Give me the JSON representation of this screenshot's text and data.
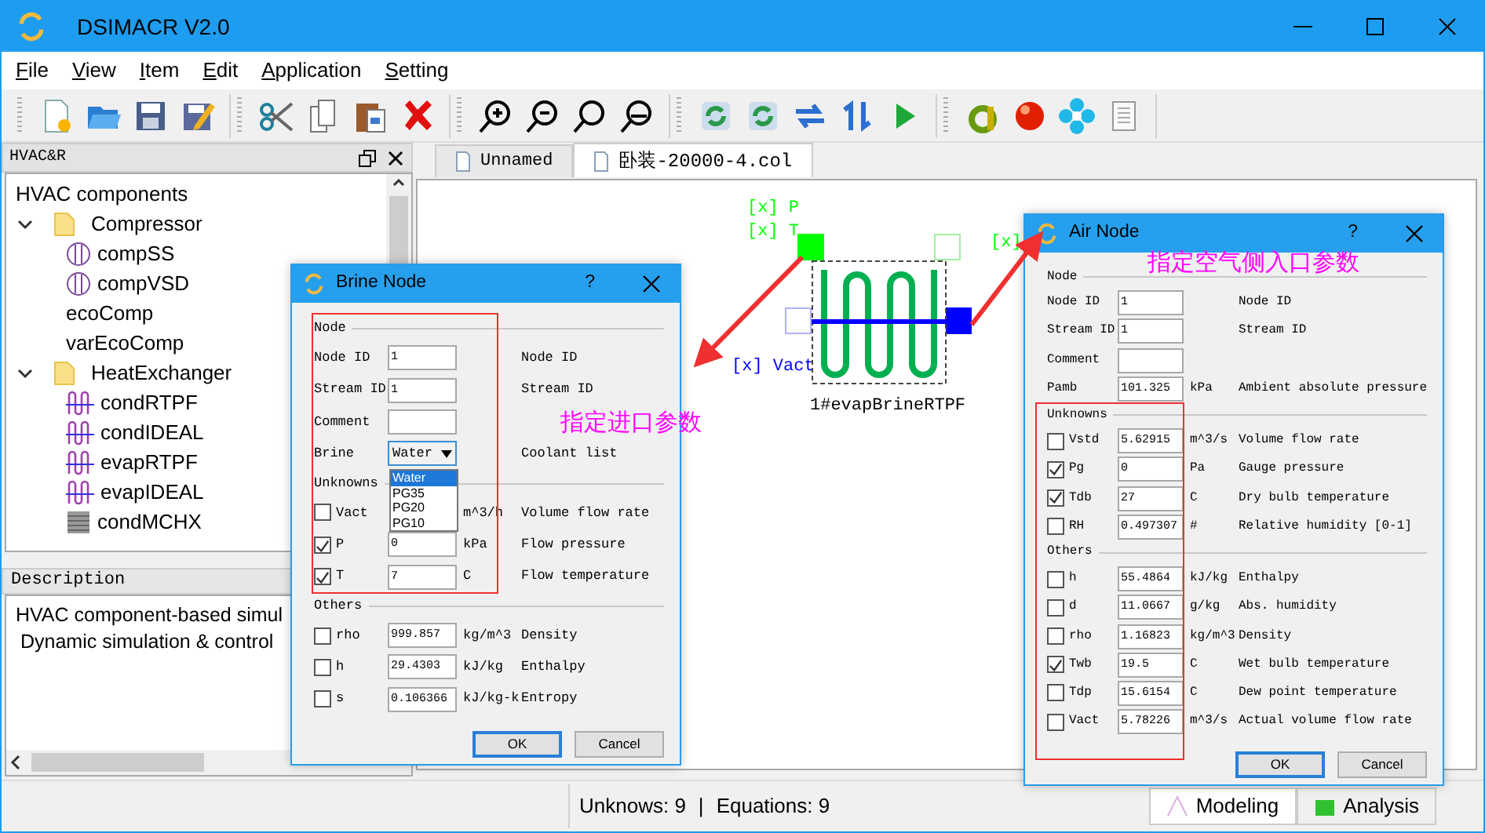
{
  "window": {
    "title": "DSIMACR V2.0"
  },
  "menu": [
    {
      "label": "File"
    },
    {
      "label": "View"
    },
    {
      "label": "Item"
    },
    {
      "label": "Edit"
    },
    {
      "label": "Application"
    },
    {
      "label": "Setting"
    }
  ],
  "dock": {
    "title": "HVAC&R"
  },
  "tree": {
    "root": "HVAC components",
    "items": [
      {
        "label": "Compressor",
        "kind": "folder",
        "expanded": true,
        "children": [
          {
            "label": "compSS",
            "kind": "compressor"
          },
          {
            "label": "compVSD",
            "kind": "compressor"
          },
          {
            "label": "ecoComp",
            "kind": "plain"
          },
          {
            "label": "varEcoComp",
            "kind": "plain"
          }
        ]
      },
      {
        "label": "HeatExchanger",
        "kind": "folder",
        "expanded": true,
        "children": [
          {
            "label": "condRTPF",
            "kind": "coil"
          },
          {
            "label": "condIDEAL",
            "kind": "coil"
          },
          {
            "label": "evapRTPF",
            "kind": "coil"
          },
          {
            "label": "evapIDEAL",
            "kind": "coil"
          },
          {
            "label": "condMCHX",
            "kind": "grid"
          }
        ]
      }
    ]
  },
  "description": {
    "title": "Description",
    "lines": [
      "HVAC component-based simul",
      "Dynamic simulation & control"
    ]
  },
  "tabs": [
    {
      "label": "Unnamed",
      "selected": false
    },
    {
      "label": "卧装-20000-4.col",
      "selected": true
    }
  ],
  "canvas": {
    "labels": [
      {
        "text": "[x] P",
        "color": "#00ff00"
      },
      {
        "text": "[x] T",
        "color": "#00ff00"
      },
      {
        "text": "[x] Vact",
        "color": "#0000ff"
      },
      {
        "text": "[x]",
        "color": "#00ff00"
      }
    ],
    "component": "1#evapBrineRTPF"
  },
  "annotations": [
    "指定进口参数",
    "指定空气侧入口参数"
  ],
  "brine_dialog": {
    "title": "Brine Node",
    "help": "?",
    "sections": [
      {
        "title": "Node",
        "rows": [
          {
            "kind": "field",
            "label": "Node ID",
            "value": "1",
            "description": "Node ID"
          },
          {
            "kind": "field",
            "label": "Stream ID",
            "value": "1",
            "description": "Stream ID"
          },
          {
            "kind": "field",
            "label": "Comment"
          },
          {
            "kind": "combo",
            "label": "Brine",
            "value": "Water",
            "description": "Coolant list",
            "options": [
              {
                "label": "Water",
                "selected": true
              },
              {
                "label": "PG35",
                "selected": false
              },
              {
                "label": "PG20",
                "selected": false
              },
              {
                "label": "PG10",
                "selected": false
              }
            ]
          }
        ]
      },
      {
        "title": "Unknowns",
        "rows": [
          {
            "kind": "check",
            "label": "Vact",
            "checked": false,
            "unit": "m^3/h",
            "description": "Volume flow rate"
          },
          {
            "kind": "check",
            "label": "P",
            "checked": true,
            "value": "0",
            "unit": "kPa",
            "description": "Flow pressure"
          },
          {
            "kind": "check",
            "label": "T",
            "checked": true,
            "value": "7",
            "unit": "C",
            "description": "Flow temperature"
          }
        ]
      },
      {
        "title": "Others",
        "rows": [
          {
            "kind": "check",
            "label": "rho",
            "checked": false,
            "value": "999.857",
            "unit": "kg/m^3",
            "description": "Density"
          },
          {
            "kind": "check",
            "label": "h",
            "checked": false,
            "value": "29.4303",
            "unit": "kJ/kg",
            "description": "Enthalpy"
          },
          {
            "kind": "check",
            "label": "s",
            "checked": false,
            "value": "0.106366",
            "unit": "kJ/kg-k",
            "description": "Entropy"
          }
        ]
      }
    ],
    "buttons": [
      {
        "label": "OK",
        "default": true
      },
      {
        "label": "Cancel",
        "default": false
      }
    ]
  },
  "air_dialog": {
    "title": "Air Node",
    "help": "?",
    "sections": [
      {
        "title": "Node",
        "rows": [
          {
            "kind": "field",
            "label": "Node ID",
            "value": "1",
            "description": "Node ID"
          },
          {
            "kind": "field",
            "label": "Stream ID",
            "value": "1",
            "description": "Stream ID"
          },
          {
            "kind": "field",
            "label": "Comment"
          },
          {
            "kind": "field",
            "label": "Pamb",
            "value": "101.325",
            "unit": "kPa",
            "description": "Ambient absolute pressure"
          }
        ]
      },
      {
        "title": "Unknowns",
        "rows": [
          {
            "kind": "check",
            "label": "Vstd",
            "checked": false,
            "value": "5.62915",
            "unit": "m^3/s",
            "description": "Volume flow rate"
          },
          {
            "kind": "check",
            "label": "Pg",
            "checked": true,
            "value": "0",
            "unit": "Pa",
            "description": "Gauge pressure"
          },
          {
            "kind": "check",
            "label": "Tdb",
            "checked": true,
            "value": "27",
            "unit": "C",
            "description": "Dry bulb temperature"
          },
          {
            "kind": "check",
            "label": "RH",
            "checked": false,
            "value": "0.497307",
            "unit": "#",
            "description": "Relative humidity [0-1]"
          }
        ]
      },
      {
        "title": "Others",
        "rows": [
          {
            "kind": "check",
            "label": "h",
            "checked": false,
            "value": "55.4864",
            "unit": "kJ/kg",
            "description": "Enthalpy"
          },
          {
            "kind": "check",
            "label": "d",
            "checked": false,
            "value": "11.0667",
            "unit": "g/kg",
            "description": "Abs. humidity"
          },
          {
            "kind": "check",
            "label": "rho",
            "checked": false,
            "value": "1.16823",
            "unit": "kg/m^3",
            "description": "Density"
          },
          {
            "kind": "check",
            "label": "Twb",
            "checked": true,
            "value": "19.5",
            "unit": "C",
            "description": "Wet bulb temperature"
          },
          {
            "kind": "check",
            "label": "Tdp",
            "checked": false,
            "value": "15.6154",
            "unit": "C",
            "description": "Dew point temperature"
          },
          {
            "kind": "check",
            "label": "Vact",
            "checked": false,
            "value": "5.78226",
            "unit": "m^3/s",
            "description": "Actual volume flow rate"
          }
        ]
      }
    ],
    "buttons": [
      {
        "label": "OK",
        "default": true
      },
      {
        "label": "Cancel",
        "default": false
      }
    ]
  },
  "status_bar": {
    "unknowns": "Unknows: 9",
    "separator": "|",
    "equations": "Equations: 9",
    "views": [
      {
        "label": "Modeling",
        "selected": true
      },
      {
        "label": "Analysis",
        "selected": false
      }
    ]
  }
}
